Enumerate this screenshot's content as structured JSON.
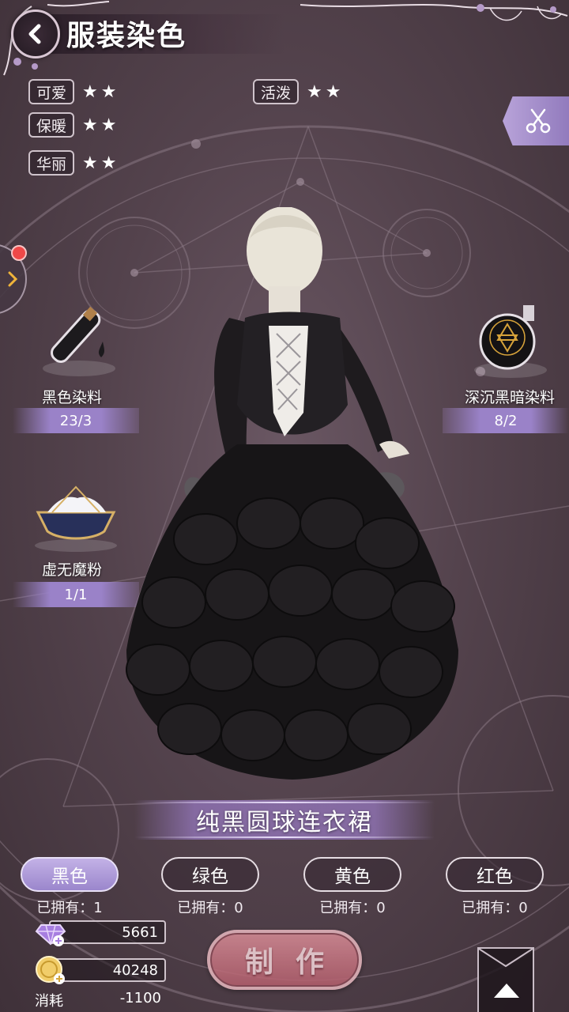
{
  "header": {
    "title": "服装染色"
  },
  "attributes": [
    {
      "label": "可爱",
      "stars": "★★",
      "rating": 2
    },
    {
      "label": "保暖",
      "stars": "★★",
      "rating": 2
    },
    {
      "label": "华丽",
      "stars": "★★",
      "rating": 2
    },
    {
      "label": "活泼",
      "stars": "★★",
      "rating": 2
    }
  ],
  "materials": [
    {
      "name": "黑色染料",
      "count": "23/3",
      "icon": "black-dye-bottle-icon"
    },
    {
      "name": "深沉黑暗染料",
      "count": "8/2",
      "icon": "dark-potion-icon"
    },
    {
      "name": "虚无魔粉",
      "count": "1/1",
      "icon": "void-powder-bowl-icon"
    }
  ],
  "outfit": {
    "name": "纯黑圆球连衣裙"
  },
  "color_options": [
    {
      "label": "黑色",
      "owned": "已拥有：1",
      "selected": true
    },
    {
      "label": "绿色",
      "owned": "已拥有：0",
      "selected": false
    },
    {
      "label": "黄色",
      "owned": "已拥有：0",
      "selected": false
    },
    {
      "label": "红色",
      "owned": "已拥有：0",
      "selected": false
    }
  ],
  "currency": {
    "diamonds": "5661",
    "coins": "40248",
    "cost_label": "消耗",
    "cost_value": "-1100"
  },
  "actions": {
    "make_label": "制作"
  },
  "colors": {
    "accent_purple": "#9a82c8",
    "make_button": "#c97481",
    "notification": "#ef4848",
    "background": "#54434d"
  }
}
